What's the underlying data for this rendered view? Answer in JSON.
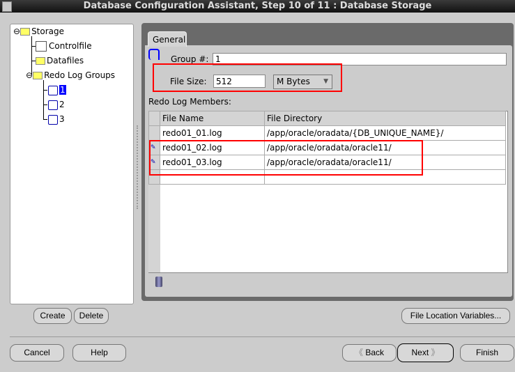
{
  "window": {
    "title": "Database Configuration Assistant, Step 10 of 11 : Database Storage"
  },
  "tree": {
    "root": "Storage",
    "items": [
      "Controlfile",
      "Datafiles",
      "Redo Log Groups"
    ],
    "groups": [
      "1",
      "2",
      "3"
    ],
    "selected": "1"
  },
  "tab": {
    "label": "General"
  },
  "form": {
    "group_label": "Group #:",
    "group_value": "1",
    "size_label": "File Size:",
    "size_value": "512",
    "unit": "M Bytes"
  },
  "members": {
    "label": "Redo Log Members:",
    "columns": [
      "File Name",
      "File Directory"
    ],
    "rows": [
      [
        "redo01_01.log",
        "/app/oracle/oradata/{DB_UNIQUE_NAME}/"
      ],
      [
        "redo01_02.log",
        "/app/oracle/oradata/oracle11/"
      ],
      [
        "redo01_03.log",
        "/app/oracle/oradata/oracle11/"
      ]
    ]
  },
  "buttons": {
    "create": "Create",
    "delete": "Delete",
    "file_location": "File Location Variables...",
    "cancel": "Cancel",
    "help": "Help",
    "back": "Back",
    "next": "Next",
    "finish": "Finish"
  },
  "colors": {
    "highlight": "#ff0000",
    "selection": "#0000ff"
  }
}
